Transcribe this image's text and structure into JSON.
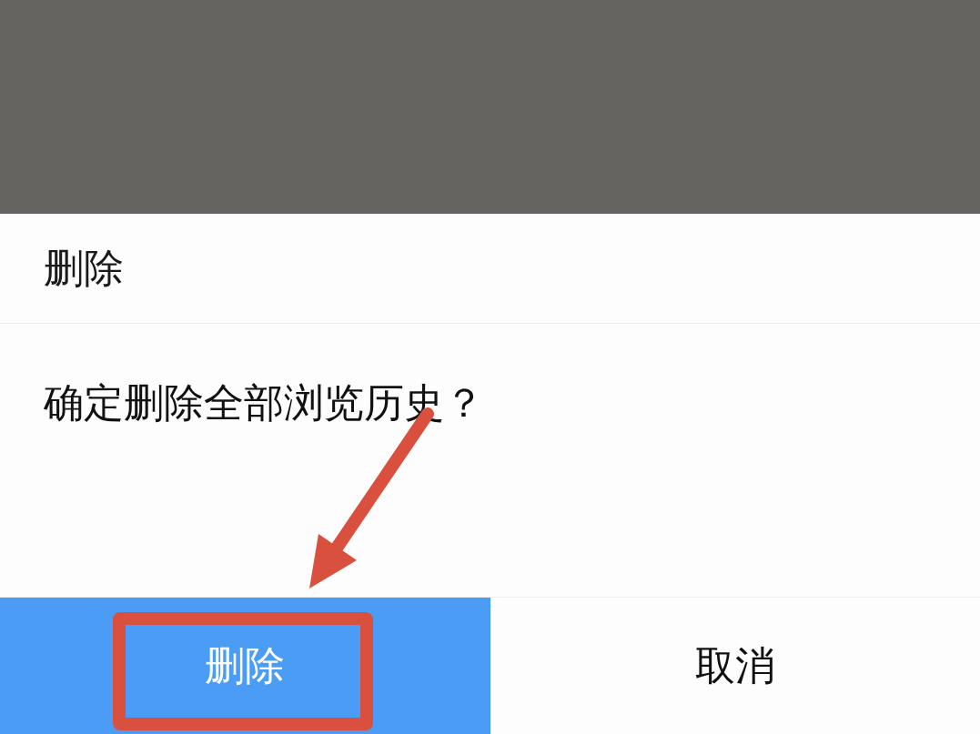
{
  "dialog": {
    "title": "删除",
    "message": "确定删除全部浏览历史？",
    "buttons": [
      {
        "label": "删除",
        "kind": "primary",
        "highlighted": true
      },
      {
        "label": "取消",
        "kind": "secondary",
        "highlighted": false
      }
    ]
  }
}
